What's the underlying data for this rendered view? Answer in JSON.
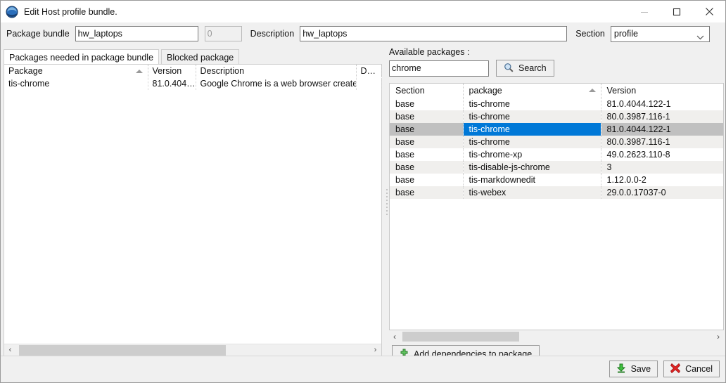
{
  "window": {
    "title": "Edit Host profile bundle.",
    "icon": "app-logo-icon",
    "minimize_label": "—",
    "maximize_label": "□",
    "close_label": "✕"
  },
  "form": {
    "package_bundle_label": "Package bundle",
    "package_bundle_value": "hw_laptops",
    "counter_value": "0",
    "description_label": "Description",
    "description_value": "hw_laptops",
    "section_label": "Section",
    "section_value": "profile"
  },
  "left": {
    "tabs": [
      {
        "label": "Packages needed in package bundle",
        "active": true
      },
      {
        "label": "Blocked package",
        "active": false
      }
    ],
    "columns": [
      "Package",
      "Version",
      "Description",
      "D…"
    ],
    "sorted_column": "Package",
    "rows": [
      {
        "package": "tis-chrome",
        "version": "81.0.404…",
        "description": "Google Chrome is a web browser created by …",
        "extra": ""
      }
    ],
    "scroll_left_arrow": "‹",
    "scroll_right_arrow": "›"
  },
  "right": {
    "available_label": "Available packages :",
    "search_value": "chrome",
    "search_placeholder": "",
    "search_button_label": "Search",
    "columns": [
      "Section",
      "package",
      "Version"
    ],
    "sorted_column": "package",
    "rows": [
      {
        "section": "base",
        "package": "tis-chrome",
        "version": "81.0.4044.122-1",
        "selected": false
      },
      {
        "section": "base",
        "package": "tis-chrome",
        "version": "80.0.3987.116-1",
        "selected": false
      },
      {
        "section": "base",
        "package": "tis-chrome",
        "version": "81.0.4044.122-1",
        "selected": true
      },
      {
        "section": "base",
        "package": "tis-chrome",
        "version": "80.0.3987.116-1",
        "selected": false
      },
      {
        "section": "base",
        "package": "tis-chrome-xp",
        "version": "49.0.2623.110-8",
        "selected": false
      },
      {
        "section": "base",
        "package": "tis-disable-js-chrome",
        "version": "3",
        "selected": false
      },
      {
        "section": "base",
        "package": "tis-markdownedit",
        "version": "1.12.0.0-2",
        "selected": false
      },
      {
        "section": "base",
        "package": "tis-webex",
        "version": "29.0.0.17037-0",
        "selected": false
      }
    ],
    "add_dependencies_label": "Add dependencies to package",
    "scroll_left_arrow": "‹",
    "scroll_right_arrow": "›"
  },
  "footer": {
    "save_label": "Save",
    "cancel_label": "Cancel"
  },
  "colors": {
    "selection_blue": "#0078d7",
    "row_selected_gray": "#c0c0c0",
    "window_bg": "#f0f0f0",
    "save_green": "#2fa82f",
    "cancel_red": "#d81e1e"
  }
}
